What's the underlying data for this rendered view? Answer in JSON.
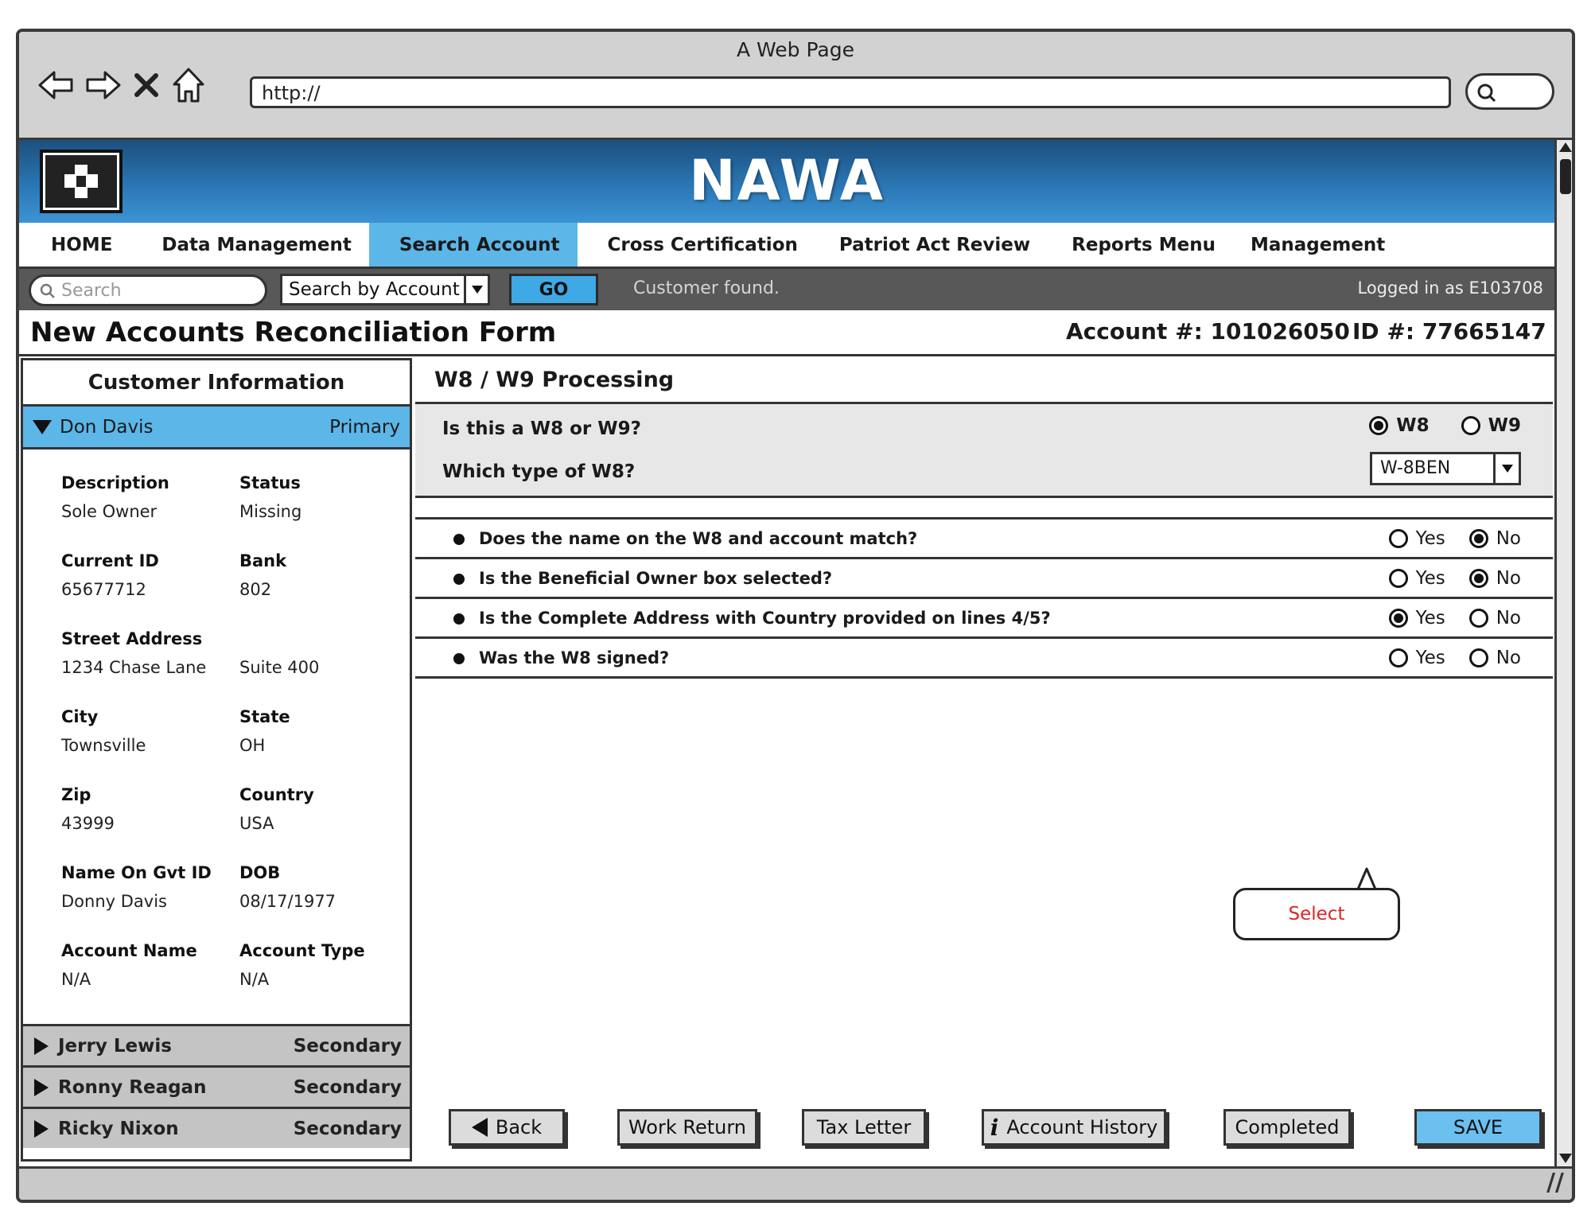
{
  "window": {
    "title": "A Web Page",
    "url": "http://"
  },
  "brand": {
    "name": "NAWA"
  },
  "nav": {
    "items": [
      "HOME",
      "Data Management",
      "Search Account",
      "Cross Certification",
      "Patriot Act Review",
      "Reports Menu",
      "Management"
    ],
    "active": "Search Account"
  },
  "toolbar": {
    "search_placeholder": "Search",
    "search_by": "Search by Account",
    "go_label": "GO",
    "status": "Customer found.",
    "logged_in": "Logged in as E103708"
  },
  "form": {
    "title": "New Accounts Reconciliation Form",
    "account": "Account #: 101026050",
    "id": "ID #: 77665147"
  },
  "customer": {
    "header": "Customer Information",
    "primary": {
      "name": "Don Davis",
      "role": "Primary"
    },
    "fields": {
      "description_label": "Description",
      "description": "Sole Owner",
      "status_label": "Status",
      "status": "Missing",
      "current_id_label": "Current ID",
      "current_id": "65677712",
      "bank_label": "Bank",
      "bank": "802",
      "street_label": "Street Address",
      "street": "1234 Chase Lane",
      "suite": "Suite 400",
      "city_label": "City",
      "city": "Townsville",
      "state_label": "State",
      "state": "OH",
      "zip_label": "Zip",
      "zip": "43999",
      "country_label": "Country",
      "country": "USA",
      "name_on_id_label": "Name On Gvt ID",
      "name_on_id": "Donny Davis",
      "dob_label": "DOB",
      "dob": "08/17/1977",
      "account_name_label": "Account Name",
      "account_name": "N/A",
      "account_type_label": "Account Type",
      "account_type": "N/A"
    },
    "others": [
      {
        "name": "Jerry Lewis",
        "role": "Secondary"
      },
      {
        "name": "Ronny Reagan",
        "role": "Secondary"
      },
      {
        "name": "Ricky Nixon",
        "role": "Secondary"
      }
    ]
  },
  "processing": {
    "title": "W8 / W9 Processing",
    "q_type": "Is this a W8 or W9?",
    "w8_label": "W8",
    "w9_label": "W9",
    "w8_selected": true,
    "q_w8_type": "Which type of W8?",
    "w8_type": "W-8BEN",
    "yes_label": "Yes",
    "no_label": "No",
    "questions": [
      {
        "text": "Does the name on the W8 and account match?",
        "answer": "No"
      },
      {
        "text": "Is the Beneficial Owner box selected?",
        "answer": "No"
      },
      {
        "text": "Is the Complete Address with Country provided on lines 4/5?",
        "answer": "Yes"
      },
      {
        "text": "Was the W8 signed?",
        "answer": ""
      }
    ],
    "callout": "Select"
  },
  "buttons": {
    "back": "Back",
    "work_return": "Work Return",
    "tax_letter": "Tax Letter",
    "account_history": "Account History",
    "completed": "Completed",
    "save": "SAVE"
  },
  "colors": {
    "accent": "#5cb6e8",
    "banner": "#2a76b4",
    "toolbar": "#585858",
    "callout_text": "#e02424"
  }
}
